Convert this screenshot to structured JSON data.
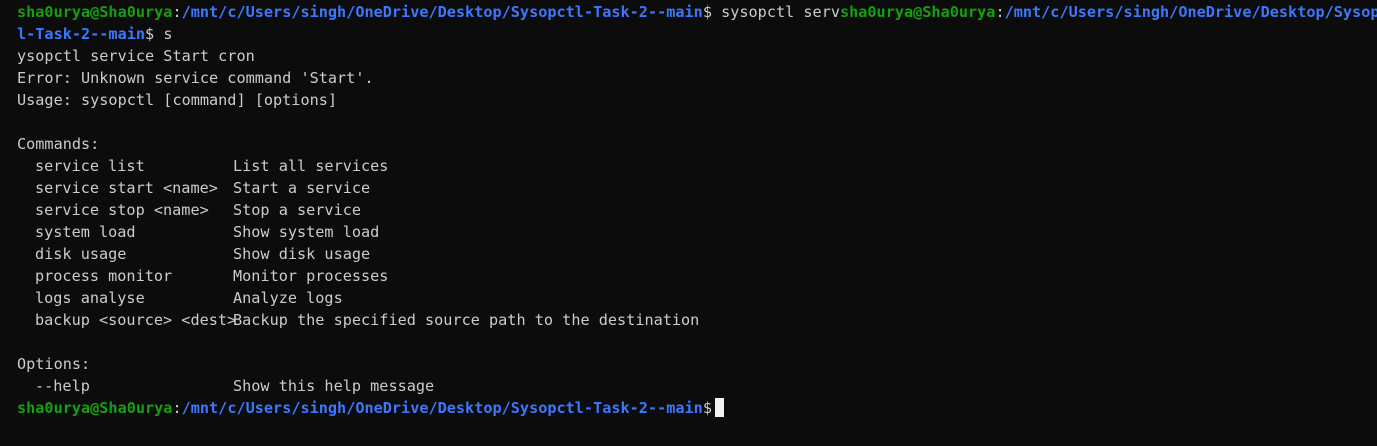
{
  "prompt": {
    "user_host": "sha0urya@Sha0urya",
    "path": "/mnt/c/Users/singh/OneDrive/Desktop/Sysopctl-Task-2--main",
    "symbol": "$"
  },
  "wrapped_line": {
    "first_command": " sysopctl serv",
    "second_path_part1": "/mnt/c/Users/singh/OneDrive/Desktop/Sysopct",
    "second_path_part2": "l-Task-2--main",
    "second_command": " s"
  },
  "output": {
    "echo_line": "ysopctl service Start cron",
    "error_line": "Error: Unknown service command 'Start'.",
    "usage_line": "Usage: sysopctl [command] [options]",
    "commands_header": "Commands:",
    "commands": [
      {
        "cmd": "service list",
        "desc": "List all services"
      },
      {
        "cmd": "service start <name>",
        "desc": "Start a service"
      },
      {
        "cmd": "service stop <name>",
        "desc": "Stop a service"
      },
      {
        "cmd": "system load",
        "desc": "Show system load"
      },
      {
        "cmd": "disk usage",
        "desc": "Show disk usage"
      },
      {
        "cmd": "process monitor",
        "desc": "Monitor processes"
      },
      {
        "cmd": "logs analyse",
        "desc": "Analyze logs"
      },
      {
        "cmd": "backup <source> <dest>",
        "desc": "Backup the specified source path to the destination"
      }
    ],
    "options_header": "Options:",
    "options": [
      {
        "cmd": "--help",
        "desc": "Show this help message"
      }
    ]
  },
  "colors": {
    "background": "#0c0c0c",
    "text": "#cccccc",
    "user_host": "#13a10e",
    "path": "#3b78ff",
    "cursor": "#f2f2f2"
  }
}
